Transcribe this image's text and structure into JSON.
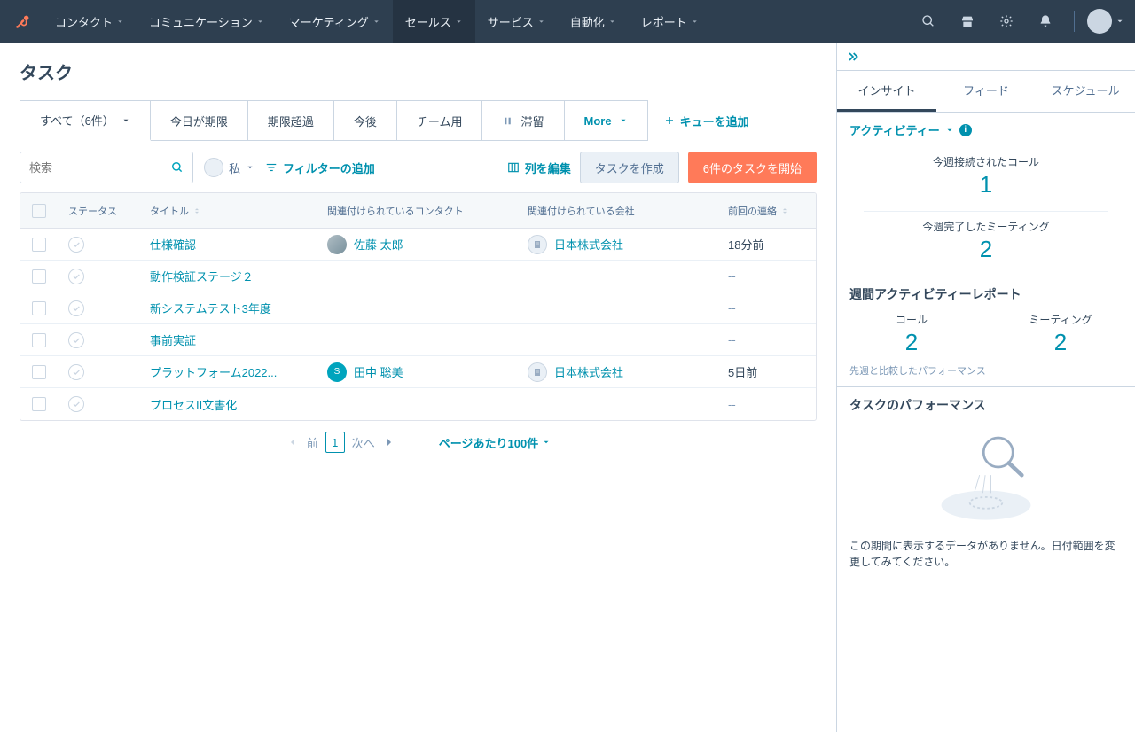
{
  "nav": {
    "items": [
      "コンタクト",
      "コミュニケーション",
      "マーケティング",
      "セールス",
      "サービス",
      "自動化",
      "レポート"
    ],
    "active_index": 3
  },
  "page_title": "タスク",
  "view_tabs": {
    "items": [
      {
        "label": "すべて（6件）",
        "has_caret": true
      },
      {
        "label": "今日が期限"
      },
      {
        "label": "期限超過"
      },
      {
        "label": "今後"
      },
      {
        "label": "チーム用"
      },
      {
        "label": "滞留",
        "icon": "pause"
      }
    ],
    "more_label": "More",
    "add_queue": "キューを追加"
  },
  "filters": {
    "search_placeholder": "検索",
    "me_label": "私",
    "add_filter": "フィルターの追加",
    "col_edit": "列を編集",
    "create_task": "タスクを作成",
    "start_tasks": "6件のタスクを開始"
  },
  "table": {
    "headers": {
      "status": "ステータス",
      "title": "タイトル",
      "contact": "関連付けられているコンタクト",
      "company": "関連付けられている会社",
      "last": "前回の連絡"
    },
    "rows": [
      {
        "title": "仕様確認",
        "contact": "佐藤 太郎",
        "contact_avatar": "photo",
        "company": "日本株式会社",
        "last": "18分前"
      },
      {
        "title": "動作検証ステージ２",
        "contact": "",
        "company": "",
        "last": "--"
      },
      {
        "title": "新システムテスト3年度",
        "contact": "",
        "company": "",
        "last": "--"
      },
      {
        "title": "事前実証",
        "contact": "",
        "company": "",
        "last": "--"
      },
      {
        "title": "プラットフォーム2022...",
        "contact": "田中 聡美",
        "contact_avatar": "initial",
        "contact_initial": "S",
        "company": "日本株式会社",
        "last": "5日前"
      },
      {
        "title": "プロセスII文書化",
        "contact": "",
        "company": "",
        "last": "--"
      }
    ]
  },
  "pagination": {
    "prev": "前",
    "page": "1",
    "next": "次へ",
    "per_page": "ページあたり100件"
  },
  "right": {
    "tabs": [
      "インサイト",
      "フィード",
      "スケジュール"
    ],
    "activity_label": "アクティビティー",
    "stat1_label": "今週接続されたコール",
    "stat1_value": "1",
    "stat2_label": "今週完了したミーティング",
    "stat2_value": "2",
    "weekly_title": "週間アクティビティーレポート",
    "calls_label": "コール",
    "calls_value": "2",
    "meetings_label": "ミーティング",
    "meetings_value": "2",
    "compared_note": "先週と比較したパフォーマンス",
    "perf_title": "タスクのパフォーマンス",
    "empty_text": "この期間に表示するデータがありません。日付範囲を変更してみてください。"
  }
}
